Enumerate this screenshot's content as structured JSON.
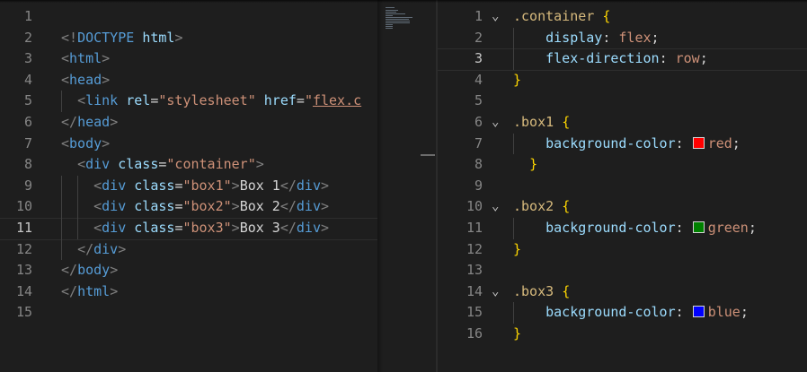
{
  "html_editor": {
    "active_line": 11,
    "lines": [
      {
        "n": "1",
        "tokens": []
      },
      {
        "n": "2",
        "tokens": [
          {
            "t": "<!",
            "c": "t-br"
          },
          {
            "t": "DOCTYPE",
            "c": "t-tag"
          },
          {
            "t": " ",
            "c": "t-txt"
          },
          {
            "t": "html",
            "c": "t-attr"
          },
          {
            "t": ">",
            "c": "t-br"
          }
        ]
      },
      {
        "n": "3",
        "tokens": [
          {
            "t": "<",
            "c": "t-br"
          },
          {
            "t": "html",
            "c": "t-tag"
          },
          {
            "t": ">",
            "c": "t-br"
          }
        ]
      },
      {
        "n": "4",
        "tokens": [
          {
            "t": "<",
            "c": "t-br"
          },
          {
            "t": "head",
            "c": "t-tag"
          },
          {
            "t": ">",
            "c": "t-br"
          }
        ]
      },
      {
        "n": "5",
        "tokens": [
          {
            "t": "  ",
            "c": "t-txt"
          },
          {
            "t": "<",
            "c": "t-br"
          },
          {
            "t": "link",
            "c": "t-tag"
          },
          {
            "t": " ",
            "c": "t-txt"
          },
          {
            "t": "rel",
            "c": "t-attr"
          },
          {
            "t": "=",
            "c": "t-txt"
          },
          {
            "t": "\"stylesheet\"",
            "c": "t-str"
          },
          {
            "t": " ",
            "c": "t-txt"
          },
          {
            "t": "href",
            "c": "t-attr"
          },
          {
            "t": "=",
            "c": "t-txt"
          },
          {
            "t": "\"",
            "c": "t-str"
          },
          {
            "t": "flex.c",
            "c": "t-str t-link"
          }
        ]
      },
      {
        "n": "6",
        "tokens": [
          {
            "t": "</",
            "c": "t-br"
          },
          {
            "t": "head",
            "c": "t-tag"
          },
          {
            "t": ">",
            "c": "t-br"
          }
        ]
      },
      {
        "n": "7",
        "tokens": [
          {
            "t": "<",
            "c": "t-br"
          },
          {
            "t": "body",
            "c": "t-tag"
          },
          {
            "t": ">",
            "c": "t-br"
          }
        ]
      },
      {
        "n": "8",
        "tokens": [
          {
            "t": "  ",
            "c": "t-txt"
          },
          {
            "t": "<",
            "c": "t-br"
          },
          {
            "t": "div",
            "c": "t-tag"
          },
          {
            "t": " ",
            "c": "t-txt"
          },
          {
            "t": "class",
            "c": "t-attr"
          },
          {
            "t": "=",
            "c": "t-txt"
          },
          {
            "t": "\"container\"",
            "c": "t-str"
          },
          {
            "t": ">",
            "c": "t-br"
          }
        ]
      },
      {
        "n": "9",
        "tokens": [
          {
            "t": "    ",
            "c": "t-txt"
          },
          {
            "t": "<",
            "c": "t-br"
          },
          {
            "t": "div",
            "c": "t-tag"
          },
          {
            "t": " ",
            "c": "t-txt"
          },
          {
            "t": "class",
            "c": "t-attr"
          },
          {
            "t": "=",
            "c": "t-txt"
          },
          {
            "t": "\"box1\"",
            "c": "t-str"
          },
          {
            "t": ">",
            "c": "t-br"
          },
          {
            "t": "Box 1",
            "c": "t-txt"
          },
          {
            "t": "</",
            "c": "t-br"
          },
          {
            "t": "div",
            "c": "t-tag"
          },
          {
            "t": ">",
            "c": "t-br"
          }
        ]
      },
      {
        "n": "10",
        "tokens": [
          {
            "t": "    ",
            "c": "t-txt"
          },
          {
            "t": "<",
            "c": "t-br"
          },
          {
            "t": "div",
            "c": "t-tag"
          },
          {
            "t": " ",
            "c": "t-txt"
          },
          {
            "t": "class",
            "c": "t-attr"
          },
          {
            "t": "=",
            "c": "t-txt"
          },
          {
            "t": "\"box2\"",
            "c": "t-str"
          },
          {
            "t": ">",
            "c": "t-br"
          },
          {
            "t": "Box 2",
            "c": "t-txt"
          },
          {
            "t": "</",
            "c": "t-br"
          },
          {
            "t": "div",
            "c": "t-tag"
          },
          {
            "t": ">",
            "c": "t-br"
          }
        ]
      },
      {
        "n": "11",
        "tokens": [
          {
            "t": "    ",
            "c": "t-txt"
          },
          {
            "t": "<",
            "c": "t-br"
          },
          {
            "t": "div",
            "c": "t-tag"
          },
          {
            "t": " ",
            "c": "t-txt"
          },
          {
            "t": "class",
            "c": "t-attr"
          },
          {
            "t": "=",
            "c": "t-txt"
          },
          {
            "t": "\"box3\"",
            "c": "t-str"
          },
          {
            "t": ">",
            "c": "t-br"
          },
          {
            "t": "Box 3",
            "c": "t-txt"
          },
          {
            "t": "</",
            "c": "t-br"
          },
          {
            "t": "div",
            "c": "t-tag"
          },
          {
            "t": ">",
            "c": "t-br"
          }
        ]
      },
      {
        "n": "12",
        "tokens": [
          {
            "t": "  ",
            "c": "t-txt"
          },
          {
            "t": "</",
            "c": "t-br"
          },
          {
            "t": "div",
            "c": "t-tag"
          },
          {
            "t": ">",
            "c": "t-br"
          }
        ]
      },
      {
        "n": "13",
        "tokens": [
          {
            "t": "</",
            "c": "t-br"
          },
          {
            "t": "body",
            "c": "t-tag"
          },
          {
            "t": ">",
            "c": "t-br"
          }
        ]
      },
      {
        "n": "14",
        "tokens": [
          {
            "t": "</",
            "c": "t-br"
          },
          {
            "t": "html",
            "c": "t-tag"
          },
          {
            "t": ">",
            "c": "t-br"
          }
        ]
      },
      {
        "n": "15",
        "tokens": []
      }
    ]
  },
  "css_editor": {
    "active_line": 3,
    "lines": [
      {
        "n": "1",
        "fold": "⌄",
        "tokens": [
          {
            "t": ".container",
            "c": "t-sel"
          },
          {
            "t": " ",
            "c": "t-pun"
          },
          {
            "t": "{",
            "c": "t-brace"
          }
        ]
      },
      {
        "n": "2",
        "tokens": [
          {
            "t": "    ",
            "c": "t-pun"
          },
          {
            "t": "display",
            "c": "t-prop"
          },
          {
            "t": ": ",
            "c": "t-pun"
          },
          {
            "t": "flex",
            "c": "t-val"
          },
          {
            "t": ";",
            "c": "t-pun"
          }
        ]
      },
      {
        "n": "3",
        "tokens": [
          {
            "t": "    ",
            "c": "t-pun"
          },
          {
            "t": "flex-direction",
            "c": "t-prop"
          },
          {
            "t": ": ",
            "c": "t-pun"
          },
          {
            "t": "row",
            "c": "t-val"
          },
          {
            "t": ";",
            "c": "t-pun"
          }
        ]
      },
      {
        "n": "4",
        "tokens": [
          {
            "t": "}",
            "c": "t-brace"
          }
        ]
      },
      {
        "n": "5",
        "tokens": []
      },
      {
        "n": "6",
        "fold": "⌄",
        "tokens": [
          {
            "t": ".box1",
            "c": "t-sel"
          },
          {
            "t": " ",
            "c": "t-pun"
          },
          {
            "t": "{",
            "c": "t-brace"
          }
        ]
      },
      {
        "n": "7",
        "tokens": [
          {
            "t": "    ",
            "c": "t-pun"
          },
          {
            "t": "background-color",
            "c": "t-prop"
          },
          {
            "t": ": ",
            "c": "t-pun"
          },
          {
            "swatch": "#ff0000"
          },
          {
            "t": "red",
            "c": "t-val"
          },
          {
            "t": ";",
            "c": "t-pun"
          }
        ]
      },
      {
        "n": "8",
        "tokens": [
          {
            "t": "  ",
            "c": "t-pun"
          },
          {
            "t": "}",
            "c": "t-brace"
          }
        ]
      },
      {
        "n": "9",
        "tokens": []
      },
      {
        "n": "10",
        "fold": "⌄",
        "tokens": [
          {
            "t": ".box2",
            "c": "t-sel"
          },
          {
            "t": " ",
            "c": "t-pun"
          },
          {
            "t": "{",
            "c": "t-brace"
          }
        ]
      },
      {
        "n": "11",
        "tokens": [
          {
            "t": "    ",
            "c": "t-pun"
          },
          {
            "t": "background-color",
            "c": "t-prop"
          },
          {
            "t": ": ",
            "c": "t-pun"
          },
          {
            "swatch": "#008000"
          },
          {
            "t": "green",
            "c": "t-val"
          },
          {
            "t": ";",
            "c": "t-pun"
          }
        ]
      },
      {
        "n": "12",
        "tokens": [
          {
            "t": "}",
            "c": "t-brace"
          }
        ]
      },
      {
        "n": "13",
        "tokens": []
      },
      {
        "n": "14",
        "fold": "⌄",
        "tokens": [
          {
            "t": ".box3",
            "c": "t-sel"
          },
          {
            "t": " ",
            "c": "t-pun"
          },
          {
            "t": "{",
            "c": "t-brace"
          }
        ]
      },
      {
        "n": "15",
        "tokens": [
          {
            "t": "    ",
            "c": "t-pun"
          },
          {
            "t": "background-color",
            "c": "t-prop"
          },
          {
            "t": ": ",
            "c": "t-pun"
          },
          {
            "swatch": "#0000ff"
          },
          {
            "t": "blue",
            "c": "t-val"
          },
          {
            "t": ";",
            "c": "t-pun"
          }
        ]
      },
      {
        "n": "16",
        "tokens": [
          {
            "t": "}",
            "c": "t-brace"
          }
        ]
      }
    ]
  },
  "colors": {
    "editor_bg": "#1e1e1e",
    "line_number": "#858585",
    "line_number_active": "#c6c6c6",
    "tag": "#569cd6",
    "attribute": "#9cdcfe",
    "string": "#ce9178",
    "selector": "#d7ba7d",
    "brace": "#ffd700"
  }
}
